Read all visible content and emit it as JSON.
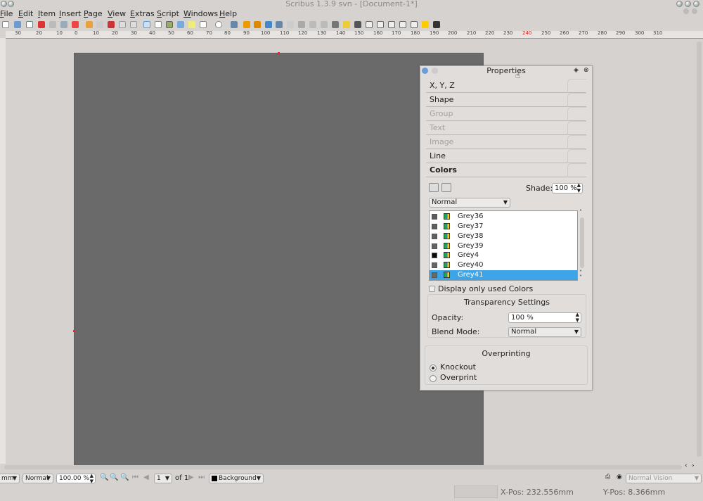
{
  "window": {
    "title": "Scribus 1.3.9 svn - [Document-1*]"
  },
  "menu": [
    "File",
    "Edit",
    "Item",
    "Insert",
    "Page",
    "View",
    "Extras",
    "Script",
    "Windows",
    "Help"
  ],
  "ruler": {
    "h_ticks": [
      "30",
      "20",
      "10",
      "0",
      "10",
      "20",
      "30",
      "40",
      "50",
      "60",
      "70",
      "80",
      "90",
      "100",
      "110",
      "120",
      "130",
      "140",
      "150",
      "160",
      "170",
      "180",
      "190",
      "200",
      "210",
      "220",
      "230",
      "240",
      "250",
      "260",
      "270",
      "280",
      "290",
      "300",
      "310"
    ]
  },
  "properties": {
    "title": "Properties",
    "sections": [
      "X, Y, Z",
      "Shape",
      "Group",
      "Text",
      "Image",
      "Line",
      "Colors"
    ],
    "shade_label": "Shade:",
    "shade_value": "100 %",
    "fill_mode": "Normal",
    "colors": [
      {
        "name": "Grey36",
        "swatch": "#5c5c5c"
      },
      {
        "name": "Grey37",
        "swatch": "#5e5e5e"
      },
      {
        "name": "Grey38",
        "swatch": "#616161"
      },
      {
        "name": "Grey39",
        "swatch": "#636363"
      },
      {
        "name": "Grey4",
        "swatch": "#0a0a0a"
      },
      {
        "name": "Grey40",
        "swatch": "#666666"
      },
      {
        "name": "Grey41",
        "swatch": "#696969"
      }
    ],
    "display_used_label": "Display only used Colors",
    "transparency": {
      "title": "Transparency Settings",
      "opacity_label": "Opacity:",
      "opacity_value": "100 %",
      "blend_label": "Blend Mode:",
      "blend_value": "Normal"
    },
    "overprinting": {
      "title": "Overprinting",
      "knockout": "Knockout",
      "overprint": "Overprint"
    }
  },
  "statusbar": {
    "unit": "mm",
    "mode": "Normal",
    "zoom": "100.00 %",
    "page": "1",
    "of_pages": "of 1",
    "layer": "Background",
    "vision": "Normal Vision"
  },
  "coords": {
    "x": "X-Pos: 232.556mm",
    "y": "Y-Pos: 8.366mm"
  }
}
